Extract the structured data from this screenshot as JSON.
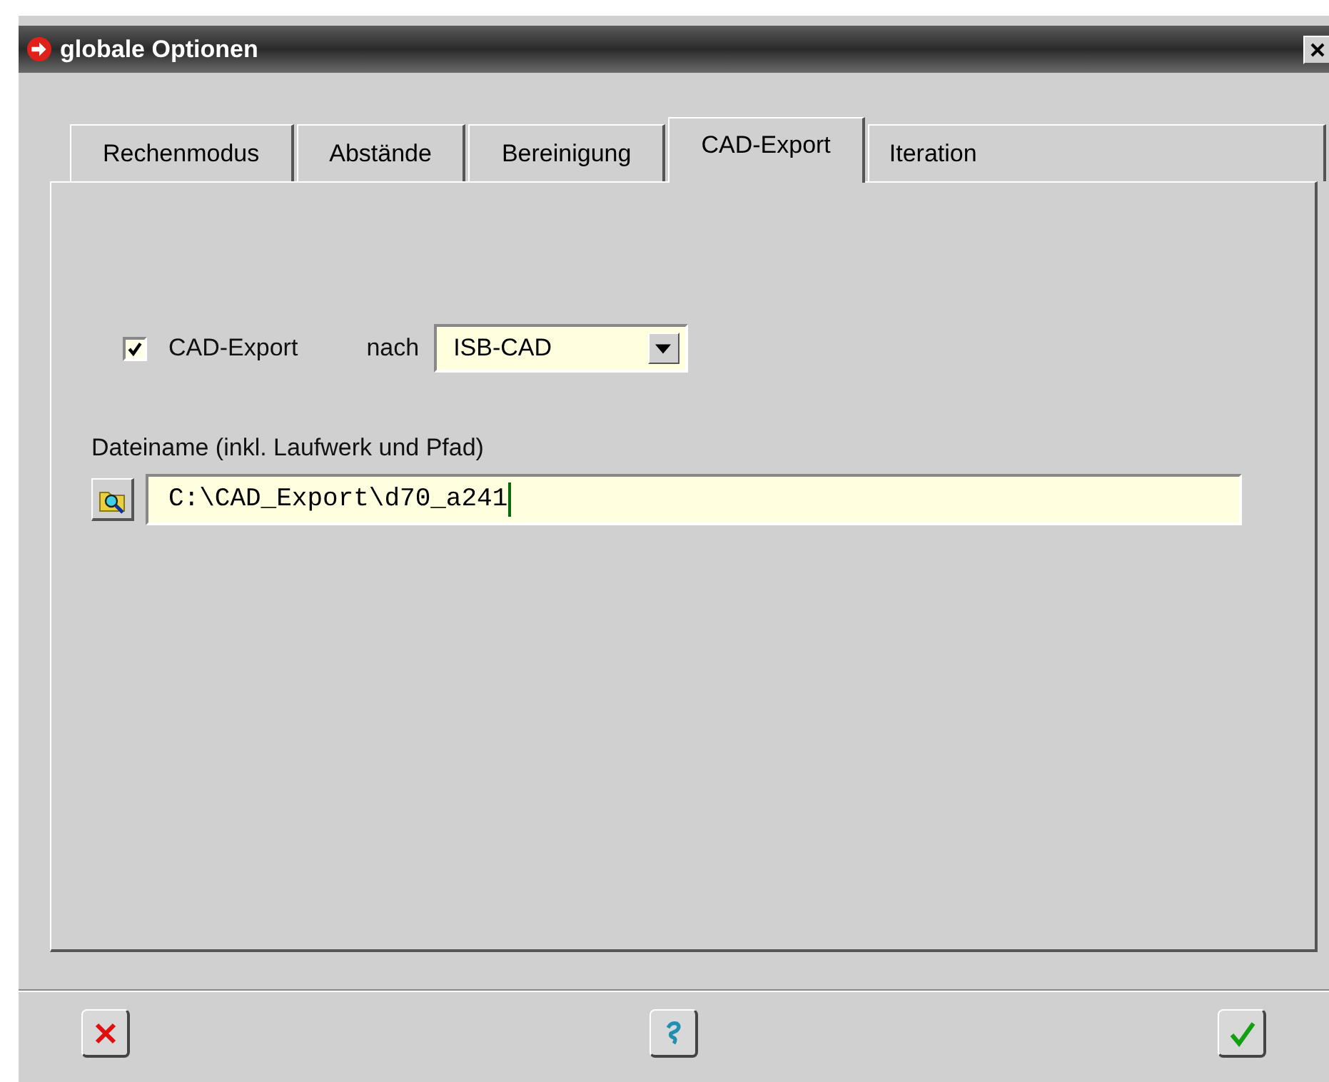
{
  "window": {
    "title": "globale Optionen"
  },
  "tabs": [
    {
      "label": "Rechenmodus",
      "selected": false
    },
    {
      "label": "Abstände",
      "selected": false
    },
    {
      "label": "Bereinigung",
      "selected": false
    },
    {
      "label": "CAD-Export",
      "selected": true
    },
    {
      "label": "Iteration",
      "selected": false
    }
  ],
  "export": {
    "checkbox_label": "CAD-Export",
    "checked": true,
    "target_label": "nach",
    "target_value": "ISB-CAD"
  },
  "file": {
    "label": "Dateiname (inkl. Laufwerk und Pfad)",
    "value": "C:\\CAD_Export\\d70_a241"
  }
}
